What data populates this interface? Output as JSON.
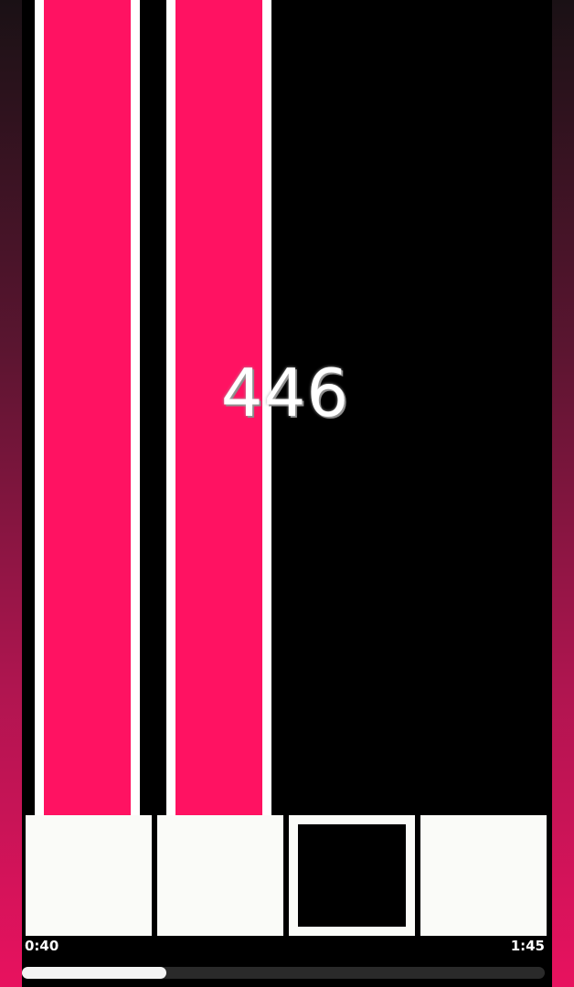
{
  "game": {
    "score": "446",
    "lanes": 4,
    "pressed_lane": 3
  },
  "playback": {
    "elapsed": "0:40",
    "total": "1:45",
    "progress_fraction": 0.276
  },
  "colors": {
    "note": "#ff1262",
    "lane_line": "#ffffff",
    "background": "#000000",
    "border_top": "#1a1115",
    "border_bottom": "#e8125f",
    "key": "#fafbf8"
  }
}
